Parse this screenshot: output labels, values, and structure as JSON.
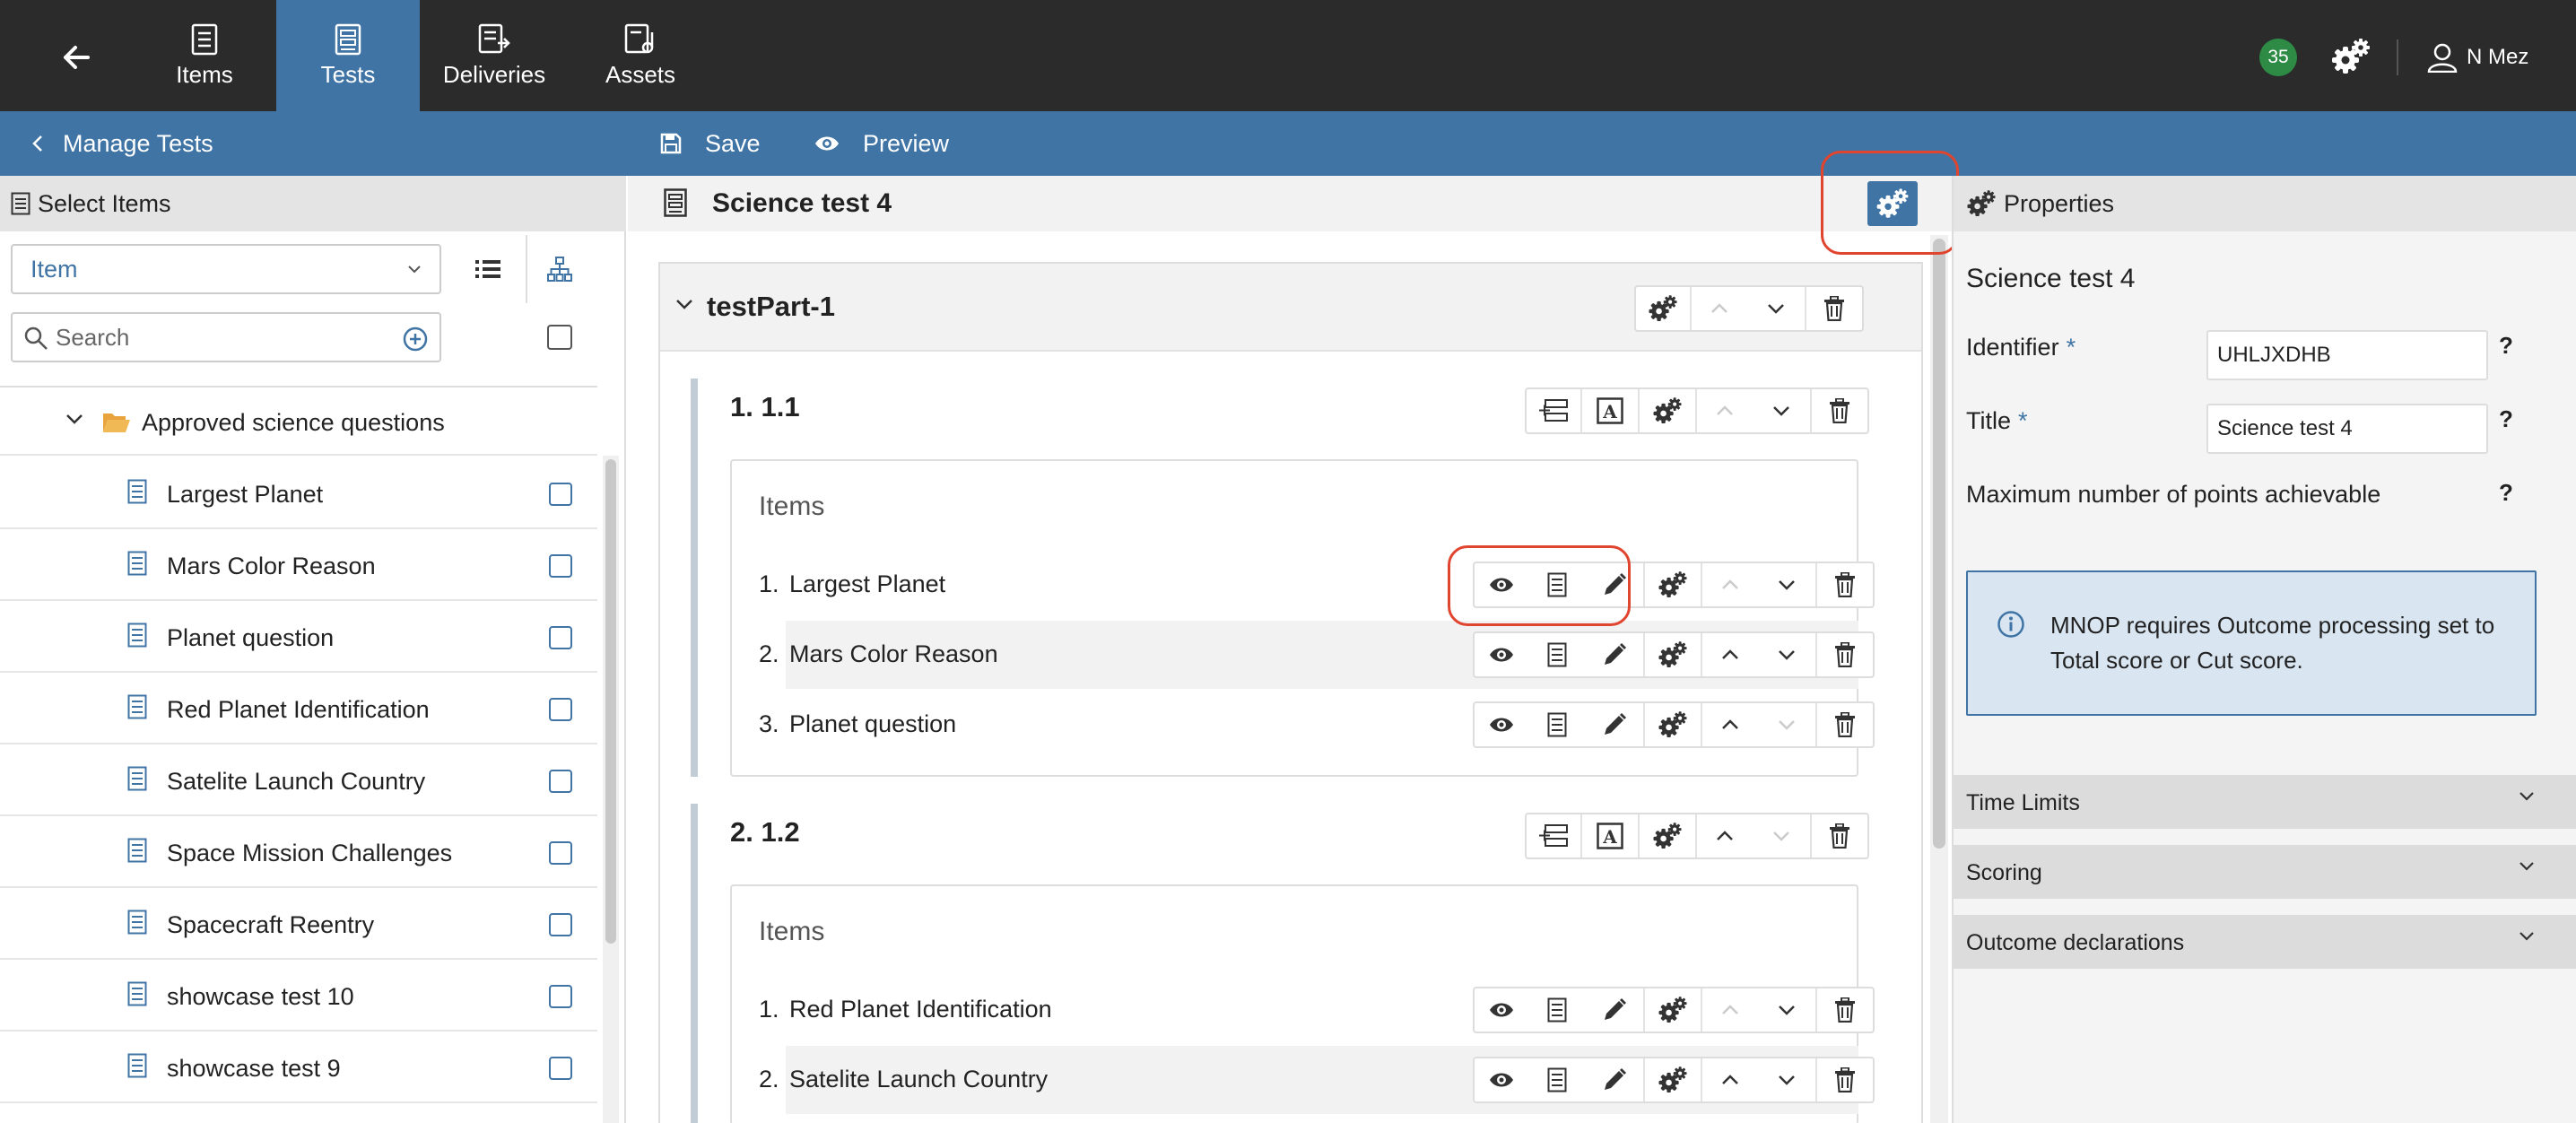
{
  "nav": {
    "tabs": [
      {
        "label": "Items",
        "icon": "items-icon"
      },
      {
        "label": "Tests",
        "icon": "tests-icon"
      },
      {
        "label": "Deliveries",
        "icon": "deliveries-icon"
      },
      {
        "label": "Assets",
        "icon": "assets-icon"
      }
    ],
    "active_tab": "Tests",
    "notification_count": "35",
    "user_name": "N Mez"
  },
  "actionbar": {
    "manage_tests": "Manage Tests",
    "save": "Save",
    "preview": "Preview"
  },
  "left": {
    "header": "Select Items",
    "filter_select": "Item",
    "search_placeholder": "Search",
    "folder": "Approved science questions",
    "items": [
      "Largest Planet",
      "Mars Color Reason",
      "Planet question",
      "Red Planet Identification",
      "Satelite Launch Country",
      "Space Mission Challenges",
      "Spacecraft Reentry",
      "showcase test 10",
      "showcase test 9"
    ]
  },
  "center": {
    "test_title": "Science test 4",
    "test_part": "testPart-1",
    "sections": [
      {
        "title": "1. 1.1",
        "items_label": "Items",
        "items": [
          {
            "num": "1.",
            "name": "Largest Planet"
          },
          {
            "num": "2.",
            "name": "Mars Color Reason"
          },
          {
            "num": "3.",
            "name": "Planet question"
          }
        ]
      },
      {
        "title": "2. 1.2",
        "items_label": "Items",
        "items": [
          {
            "num": "1.",
            "name": "Red Planet Identification"
          },
          {
            "num": "2.",
            "name": "Satelite Launch Country"
          }
        ]
      }
    ]
  },
  "properties": {
    "header": "Properties",
    "test_title": "Science test 4",
    "identifier_label": "Identifier",
    "identifier_value": "UHLJXDHB",
    "title_label": "Title",
    "title_value": "Science test 4",
    "required_mark": "*",
    "help_mark": "?",
    "max_points_label": "Maximum number of points achievable",
    "info_text": "MNOP requires Outcome processing set to Total score or Cut score.",
    "accordions": [
      "Time Limits",
      "Scoring",
      "Outcome declarations"
    ]
  },
  "colors": {
    "topbar": "#2b2b2b",
    "brand_blue": "#3f74a5",
    "badge_green": "#2e8b45",
    "highlight_red": "#e0452f",
    "info_bg": "#d9e6f2"
  }
}
